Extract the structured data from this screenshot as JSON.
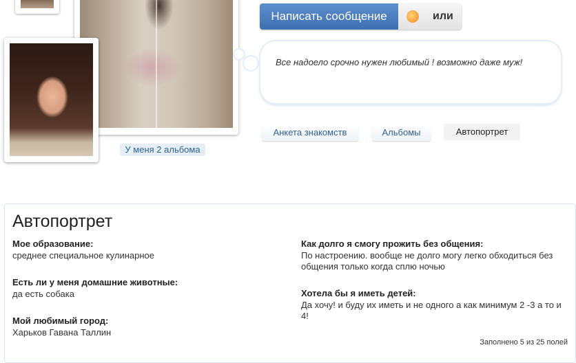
{
  "albums_link": "У меня 2 альбома",
  "actions": {
    "write_message": "Написать сообщение",
    "or": "или"
  },
  "status": "Все надоело срочно нужен любимый ! возможно даже муж!",
  "tabs": [
    "Анкета знакомств",
    "Альбомы",
    "Автопортрет"
  ],
  "panel": {
    "title": "Автопортрет",
    "fields": [
      {
        "label": "Мое образование:",
        "value": "среднее специальное кулинарное"
      },
      {
        "label": "Есть ли у меня домашние животные:",
        "value": "да есть собака"
      },
      {
        "label": "Мой любимый город:",
        "value": "Харьков Гавана Таллин"
      },
      {
        "label": "Как долго я смогу прожить без общения:",
        "value": "По настроению. вообще не долго могу легко обходиться без общения только когда сплю ночью"
      },
      {
        "label": "Хотела бы я иметь детей:",
        "value": "Да хочу! и буду их иметь и не одного а как минимум 2 -3 а то и 4!"
      }
    ],
    "filled": "Заполнено 5 из 25 полей"
  },
  "colors": {
    "accent": "#3e6fb1",
    "link": "#2f5f95",
    "cloud_border": "#e3eef8"
  },
  "icons": [
    "gift-icon"
  ]
}
